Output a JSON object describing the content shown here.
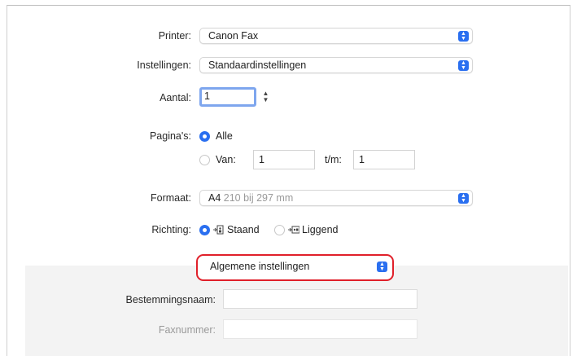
{
  "printer": {
    "label": "Printer:",
    "value": "Canon Fax"
  },
  "settings": {
    "label": "Instellingen:",
    "value": "Standaardinstellingen"
  },
  "copies": {
    "label": "Aantal:",
    "value": "1"
  },
  "pages": {
    "label": "Pagina's:",
    "all_label": "Alle",
    "from_label": "Van:",
    "from_value": "1",
    "to_label": "t/m:",
    "to_value": "1"
  },
  "format": {
    "label": "Formaat:",
    "value": "A4",
    "detail": "210 bij 297 mm"
  },
  "orientation": {
    "label": "Richting:",
    "portrait": "Staand",
    "landscape": "Liggend"
  },
  "section_popup": {
    "value": "Algemene instellingen"
  },
  "destination": {
    "label": "Bestemmingsnaam:",
    "value": ""
  },
  "fax": {
    "label": "Faxnummer:",
    "value": ""
  },
  "colors": {
    "accent": "#2a6ff0",
    "highlight": "#e0202a"
  }
}
